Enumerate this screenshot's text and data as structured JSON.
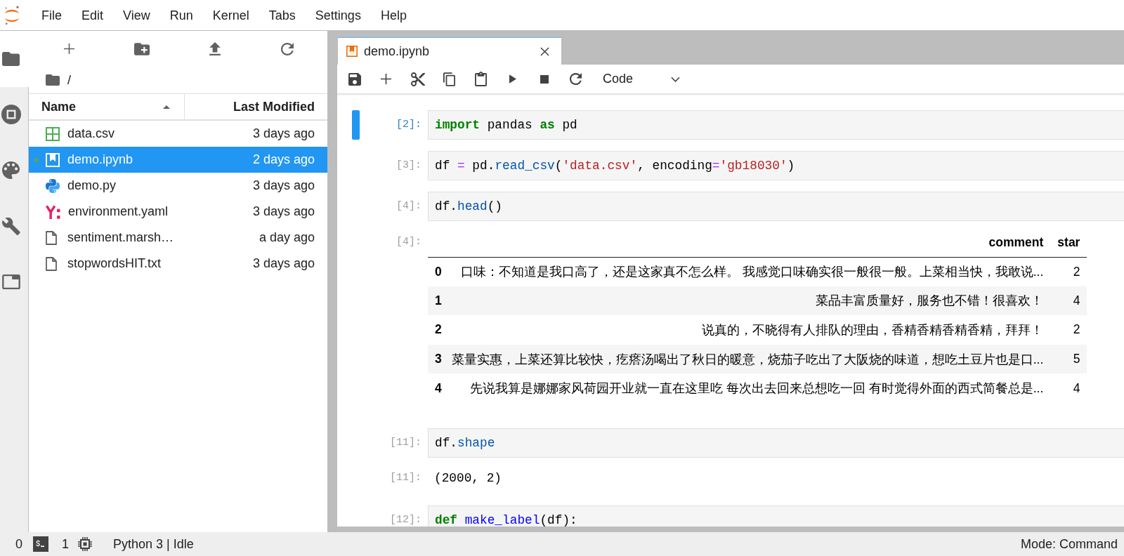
{
  "menu_bar": {
    "items": [
      "File",
      "Edit",
      "View",
      "Run",
      "Kernel",
      "Tabs",
      "Settings",
      "Help"
    ]
  },
  "left_sidebar": {
    "tabs": [
      {
        "kind": "files",
        "selected": true
      },
      {
        "kind": "running",
        "selected": false
      },
      {
        "kind": "commands",
        "selected": false
      },
      {
        "kind": "tools",
        "selected": false
      },
      {
        "kind": "open-tabs",
        "selected": false
      }
    ]
  },
  "file_browser": {
    "path": "/",
    "columns": [
      {
        "label": "Name",
        "sorted": true
      },
      {
        "label": "Last Modified",
        "sorted": false
      }
    ],
    "files": [
      {
        "kind": "spreadsheet",
        "name": "data.csv",
        "modified": "3 days ago",
        "selected": false,
        "running": false
      },
      {
        "kind": "notebook",
        "name": "demo.ipynb",
        "modified": "2 days ago",
        "selected": true,
        "running": true
      },
      {
        "kind": "python",
        "name": "demo.py",
        "modified": "3 days ago",
        "selected": false,
        "running": false
      },
      {
        "kind": "yaml",
        "name": "environment.yaml",
        "modified": "3 days ago",
        "selected": false,
        "running": false
      },
      {
        "kind": "file",
        "name": "sentiment.marsh…",
        "modified": "a day ago",
        "selected": false,
        "running": false
      },
      {
        "kind": "file",
        "name": "stopwordsHIT.txt",
        "modified": "3 days ago",
        "selected": false,
        "running": false
      }
    ]
  },
  "notebook": {
    "tab": {
      "title": "demo.ipynb"
    },
    "toolbar": {
      "cell_type": "Code"
    },
    "cells": [
      {
        "prompt": "[2]:",
        "active": true,
        "source": [
          {
            "kind": "keyword",
            "text": "import"
          },
          {
            "kind": "plain",
            "text": " pandas "
          },
          {
            "kind": "keyword",
            "text": "as"
          },
          {
            "kind": "plain",
            "text": " pd"
          }
        ]
      },
      {
        "prompt": "[3]:",
        "active": false,
        "source": [
          {
            "kind": "plain",
            "text": "df "
          },
          {
            "kind": "operator",
            "text": "="
          },
          {
            "kind": "plain",
            "text": " pd."
          },
          {
            "kind": "attribute",
            "text": "read_csv"
          },
          {
            "kind": "plain",
            "text": "("
          },
          {
            "kind": "string",
            "text": "'data.csv'"
          },
          {
            "kind": "plain",
            "text": ", encoding"
          },
          {
            "kind": "operator",
            "text": "="
          },
          {
            "kind": "string",
            "text": "'gb18030'"
          },
          {
            "kind": "plain",
            "text": ")"
          }
        ]
      },
      {
        "prompt": "[4]:",
        "active": false,
        "source": [
          {
            "kind": "plain",
            "text": "df."
          },
          {
            "kind": "attribute",
            "text": "head"
          },
          {
            "kind": "plain",
            "text": "()"
          }
        ],
        "output": {
          "kind": "table",
          "prompt": "[4]:",
          "columns": [
            "comment",
            "star"
          ],
          "rows": [
            {
              "index": "0",
              "comment": "口味：不知道是我口高了，还是这家真不怎么样。 我感觉口味确实很一般很一般。上菜相当快，我敢说...",
              "star": "2"
            },
            {
              "index": "1",
              "comment": "菜品丰富质量好，服务也不错！很喜欢！",
              "star": "4"
            },
            {
              "index": "2",
              "comment": "说真的，不晓得有人排队的理由，香精香精香精香精，拜拜！",
              "star": "2"
            },
            {
              "index": "3",
              "comment": "菜量实惠，上菜还算比较快，疙瘩汤喝出了秋日的暖意，烧茄子吃出了大阪烧的味道，想吃土豆片也是口...",
              "star": "5"
            },
            {
              "index": "4",
              "comment": "先说我算是娜娜家风荷园开业就一直在这里吃 每次出去回来总想吃一回 有时觉得外面的西式简餐总是...",
              "star": "4"
            }
          ]
        }
      },
      {
        "prompt": "[11]:",
        "active": false,
        "source": [
          {
            "kind": "plain",
            "text": "df."
          },
          {
            "kind": "attribute",
            "text": "shape"
          }
        ],
        "output": {
          "kind": "text",
          "prompt": "[11]:",
          "text": "(2000, 2)"
        }
      },
      {
        "prompt": "[12]:",
        "active": false,
        "source": [
          {
            "kind": "keyword",
            "text": "def"
          },
          {
            "kind": "definition",
            "text": " make_label"
          },
          {
            "kind": "plain",
            "text": "(df):"
          }
        ]
      }
    ]
  },
  "status_bar": {
    "terminals": "0",
    "kernels": "1",
    "kernel_status": "Python 3 | Idle",
    "mode": "Mode: Command"
  }
}
